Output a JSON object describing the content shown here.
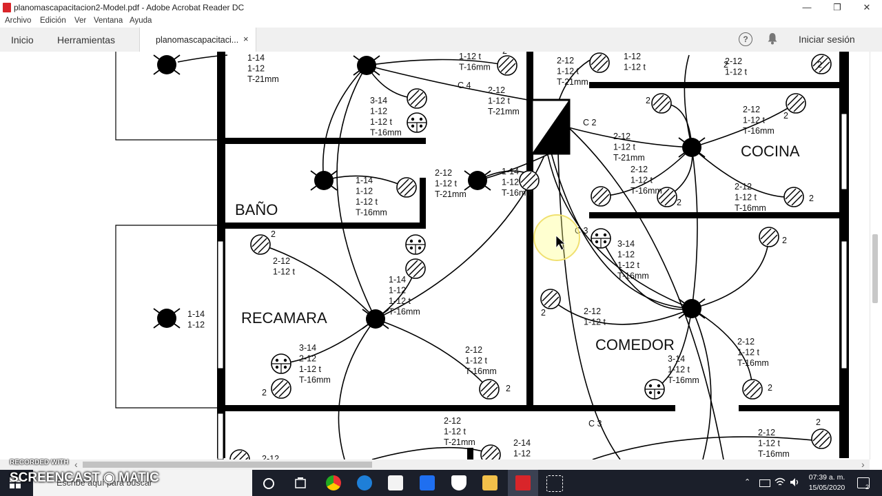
{
  "window": {
    "title": "planomascapacitacion2-Model.pdf - Adobe Acrobat Reader DC",
    "controls": [
      "—",
      "❐",
      "✕"
    ]
  },
  "menu": [
    "Archivo",
    "Edición",
    "Ver",
    "Ventana",
    "Ayuda"
  ],
  "toolbar": {
    "home": "Inicio",
    "tools": "Herramientas",
    "doc_tab": "planomascapacitaci...",
    "close": "×",
    "help": "?",
    "sign_in": "Iniciar sesión"
  },
  "plan": {
    "rooms": [
      "BAÑO",
      "RECAMARA",
      "COCINA",
      "COMEDOR"
    ],
    "labels": [
      {
        "id": "l1",
        "lines": [
          "1-14",
          "1-12",
          "T-21mm"
        ]
      },
      {
        "id": "l2",
        "lines": [
          "1-12 t",
          "T-16mm"
        ]
      },
      {
        "id": "l3",
        "lines": [
          "3-14",
          "1-12",
          "1-12 t",
          "T-16mm"
        ]
      },
      {
        "id": "l4",
        "lines": [
          "C 4"
        ]
      },
      {
        "id": "l5",
        "lines": [
          "2-12",
          "1-12 t",
          "T-21mm"
        ]
      },
      {
        "id": "l6",
        "lines": [
          "2-12",
          "1-12 t",
          "T-21mm"
        ]
      },
      {
        "id": "l7",
        "lines": [
          "1-12",
          "1-12 t"
        ]
      },
      {
        "id": "l8",
        "lines": [
          "2-12",
          "1-12 t"
        ]
      },
      {
        "id": "l9",
        "lines": [
          "2"
        ]
      },
      {
        "id": "l10",
        "lines": [
          "2-12",
          "1-12 t",
          "T-16mm"
        ]
      },
      {
        "id": "l11",
        "lines": [
          "C 2"
        ]
      },
      {
        "id": "l12",
        "lines": [
          "2-12",
          "1-12 t",
          "T-21mm"
        ]
      },
      {
        "id": "l13",
        "lines": [
          "1-14",
          "1-12",
          "1-12 t",
          "T-16mm"
        ]
      },
      {
        "id": "l14",
        "lines": [
          "2-12",
          "1-12 t",
          "T-21mm"
        ]
      },
      {
        "id": "l15",
        "lines": [
          "1-14",
          "1-12",
          "T-16mm"
        ]
      },
      {
        "id": "l16",
        "lines": [
          "2-12",
          "1-12 t",
          "T-16mm"
        ]
      },
      {
        "id": "l17",
        "lines": [
          "2-12",
          "1-12 t",
          "T-16mm"
        ]
      },
      {
        "id": "l18",
        "lines": [
          "C 3"
        ]
      },
      {
        "id": "l19",
        "lines": [
          "3-14",
          "1-12",
          "1-12 t",
          "T-16mm"
        ]
      },
      {
        "id": "l20",
        "lines": [
          "2-12",
          "1-12 t"
        ]
      },
      {
        "id": "l21",
        "lines": [
          "1-14",
          "1-12",
          "1-12 t",
          "T-16mm"
        ]
      },
      {
        "id": "l22",
        "lines": [
          "1-14",
          "1-12"
        ]
      },
      {
        "id": "l23",
        "lines": [
          "2-12",
          "1-12 t"
        ]
      },
      {
        "id": "l24",
        "lines": [
          "3-14",
          "2-12",
          "1-12 t",
          "T-16mm"
        ]
      },
      {
        "id": "l25",
        "lines": [
          "2-12",
          "1-12 t",
          "T-16mm"
        ]
      },
      {
        "id": "l26",
        "lines": [
          "3-14",
          "1-12 t",
          "T-16mm"
        ]
      },
      {
        "id": "l27",
        "lines": [
          "2-12",
          "1-12 t",
          "T-16mm"
        ]
      },
      {
        "id": "l28",
        "lines": [
          "2-12",
          "1-12 t",
          "T-21mm"
        ]
      },
      {
        "id": "l29",
        "lines": [
          "2-14",
          "1-12"
        ]
      },
      {
        "id": "l30",
        "lines": [
          "C 3"
        ]
      },
      {
        "id": "l31",
        "lines": [
          "2-12",
          "1-12 t",
          "T-16mm"
        ]
      },
      {
        "id": "l32",
        "lines": [
          "2-12"
        ]
      }
    ],
    "counts": [
      "2",
      "2",
      "2",
      "2",
      "2",
      "2",
      "2",
      "2",
      "2",
      "2",
      "2",
      "2",
      "2"
    ]
  },
  "scroll": {
    "left_arrow": "‹",
    "right_arrow": "›"
  },
  "taskbar": {
    "search_placeholder": "Escribe aquí para buscar",
    "time": "07:39 a. m.",
    "date": "15/05/2020",
    "notifications": "2"
  },
  "watermark": {
    "top": "RECORDED WITH",
    "brand": "SCREENCAST ◉ MATIC"
  }
}
